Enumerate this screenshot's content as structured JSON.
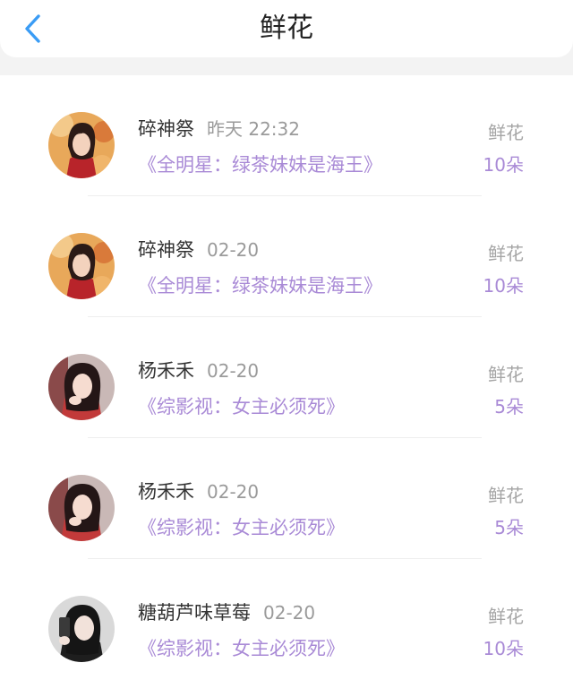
{
  "header": {
    "title": "鲜花"
  },
  "colors": {
    "accent": "#a98ad6",
    "back": "#3a9cf5"
  },
  "items": [
    {
      "name": "碎神祭",
      "time": "昨天 22:32",
      "book": "《全明星：绿茶妹妹是海王》",
      "gift_label": "鲜花",
      "count": "10朵",
      "avatar": "avatar-girl-autumn"
    },
    {
      "name": "碎神祭",
      "time": "02-20",
      "book": "《全明星：绿茶妹妹是海王》",
      "gift_label": "鲜花",
      "count": "10朵",
      "avatar": "avatar-girl-autumn"
    },
    {
      "name": "杨禾禾",
      "time": "02-20",
      "book": "《综影视：女主必须死》",
      "gift_label": "鲜花",
      "count": "5朵",
      "avatar": "avatar-girl-red"
    },
    {
      "name": "杨禾禾",
      "time": "02-20",
      "book": "《综影视：女主必须死》",
      "gift_label": "鲜花",
      "count": "5朵",
      "avatar": "avatar-girl-red"
    },
    {
      "name": "糖葫芦味草莓",
      "time": "02-20",
      "book": "《综影视：女主必须死》",
      "gift_label": "鲜花",
      "count": "10朵",
      "avatar": "avatar-girl-phone"
    }
  ]
}
